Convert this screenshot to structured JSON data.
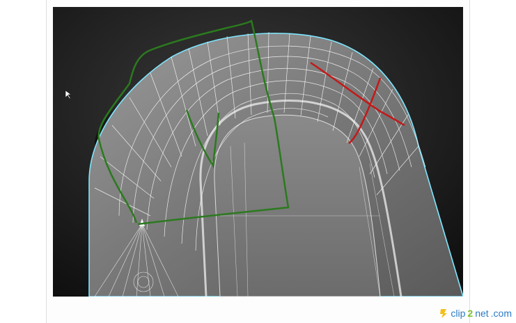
{
  "watermark": {
    "brand_prefix": "clip",
    "brand_digit": "2",
    "brand_suffix": "net",
    "brand_tld": ".com"
  },
  "viewport": {
    "background_top": "#2c2c2c",
    "background_bottom": "#0e0e0e",
    "selection_outline": "#7fe6ff",
    "annotation_green": "#2b7a1e",
    "annotation_red": "#c41818"
  }
}
